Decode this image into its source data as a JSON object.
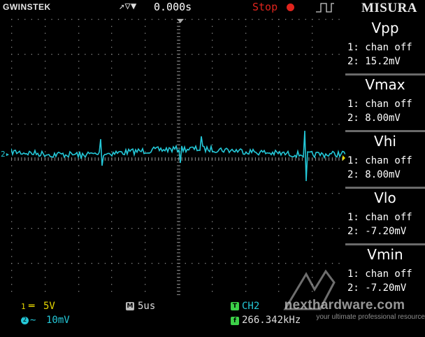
{
  "header": {
    "brand": "GWINSTEK",
    "trigger_icons": "↗▽▼",
    "time_offset": "0.000s",
    "run_state": "Stop",
    "menu_title": "MISURA"
  },
  "measurements": [
    {
      "title": "Vpp",
      "ch1": "1: chan off",
      "ch2": "2: 15.2mV"
    },
    {
      "title": "Vmax",
      "ch1": "1: chan off",
      "ch2": "2: 8.00mV"
    },
    {
      "title": "Vhi",
      "ch1": "1: chan off",
      "ch2": "2: 8.00mV"
    },
    {
      "title": "Vlo",
      "ch1": "1: chan off",
      "ch2": "2: -7.20mV"
    },
    {
      "title": "Vmin",
      "ch1": "1: chan off",
      "ch2": "2: -7.20mV"
    }
  ],
  "bottom": {
    "ch1_number": "1",
    "ch1_coupling": "═",
    "ch1_scale": "5V",
    "ch2_number": "2",
    "ch2_coupling": "∼",
    "ch2_scale": "10mV",
    "timebase_badge": "M",
    "timebase": "5us",
    "trigger_badge": "T",
    "trigger_source": "CH2",
    "freq_badge": "f",
    "frequency": "266.342kHz"
  },
  "graticule": {
    "ch2_ground_marker": "2▸"
  },
  "watermark": {
    "site": "nexthardware.com",
    "tagline": "your ultimate professional resource"
  },
  "colors": {
    "ch1": "#e8d800",
    "ch2": "#24c8d8",
    "stop": "#e0241d",
    "grid_dots": "#8a8a8a",
    "badge_green": "#3cd048"
  },
  "icons": {
    "trigger_edge": "rising-edge-icon",
    "stop_indicator": "red-dot-icon",
    "trigger_mode": "pulse-icon",
    "trigger_position": "down-triangle-icon"
  }
}
